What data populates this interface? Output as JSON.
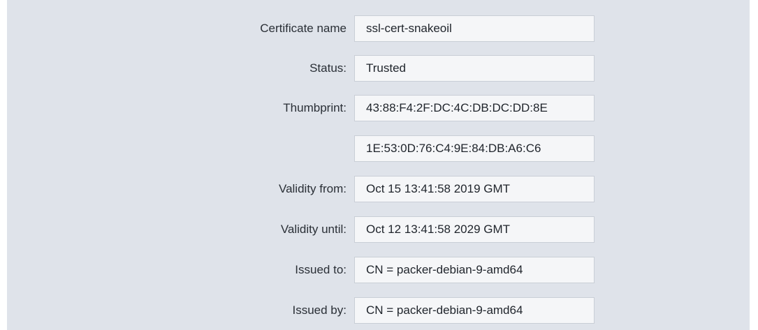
{
  "certificate": {
    "name": {
      "label": "Certificate name",
      "value": "ssl-cert-snakeoil"
    },
    "status": {
      "label": "Status:",
      "value": "Trusted"
    },
    "thumbprint": {
      "label": "Thumbprint:",
      "value_line1": "43:88:F4:2F:DC:4C:DB:DC:DD:8E",
      "value_line2": "1E:53:0D:76:C4:9E:84:DB:A6:C6"
    },
    "validity_from": {
      "label": "Validity from:",
      "value": "Oct 15 13:41:58 2019 GMT"
    },
    "validity_until": {
      "label": "Validity until:",
      "value": "Oct 12 13:41:58 2029 GMT"
    },
    "issued_to": {
      "label": "Issued to:",
      "value": "CN = packer-debian-9-amd64"
    },
    "issued_by": {
      "label": "Issued by:",
      "value": "CN = packer-debian-9-amd64"
    }
  }
}
